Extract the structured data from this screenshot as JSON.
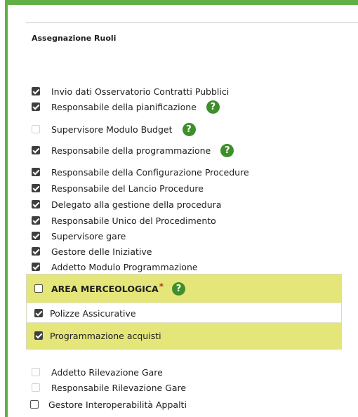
{
  "section": {
    "title": "Assegnazione Ruoli"
  },
  "roles": [
    {
      "label": "Invio dati Osservatorio Contratti Pubblici",
      "checked": true
    },
    {
      "label": "Responsabile della pianificazione",
      "checked": true,
      "help": "?"
    },
    {
      "label": "Supervisore Modulo Budget",
      "checked": false,
      "disabled": true,
      "help": "?"
    },
    {
      "label": "Responsabile della programmazione",
      "checked": true,
      "help": "?"
    },
    {
      "label": "Responsabile della Configurazione Procedure",
      "checked": true
    },
    {
      "label": "Responsabile del Lancio Procedure",
      "checked": true
    },
    {
      "label": "Delegato alla gestione della procedura",
      "checked": true
    },
    {
      "label": "Responsabile Unico del Procedimento",
      "checked": true
    },
    {
      "label": "Supervisore gare",
      "checked": true
    },
    {
      "label": "Gestore delle Iniziative",
      "checked": true
    },
    {
      "label": "Addetto Modulo Programmazione",
      "checked": true
    }
  ],
  "area": {
    "title": "AREA MERCEOLOGICA",
    "required_mark": "*",
    "help": "?",
    "checked": false,
    "items": [
      {
        "label": "Polizze Assicurative",
        "checked": true
      },
      {
        "label": "Programmazione acquisti",
        "checked": true
      }
    ]
  },
  "roles_bottom": [
    {
      "label": "Addetto Rilevazione Gare",
      "checked": false,
      "disabled": true
    },
    {
      "label": "Responsabile Rilevazione Gare",
      "checked": false,
      "disabled": true
    },
    {
      "label": "Gestore Interoperabilità Appalti",
      "checked": false
    }
  ],
  "colors": {
    "frame_green": "#62b045",
    "help_icon": "#3e8f2a",
    "highlight": "#e5e67a",
    "required": "#d9261c"
  }
}
